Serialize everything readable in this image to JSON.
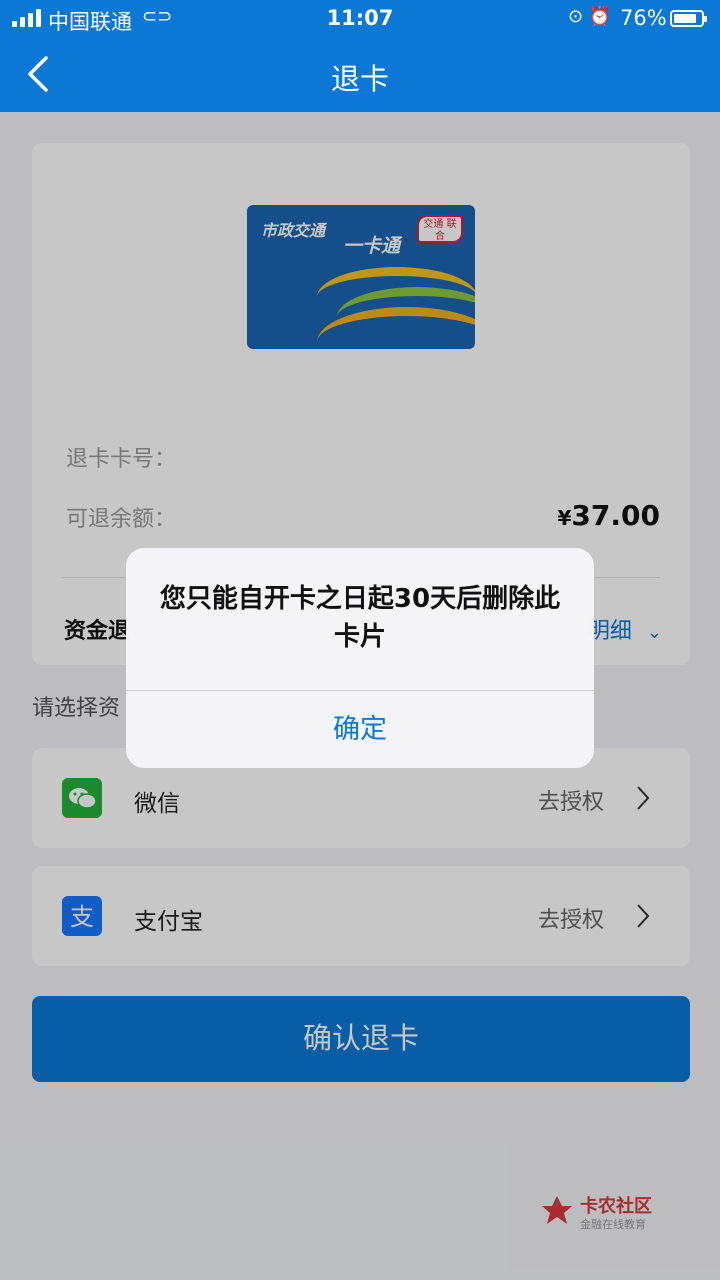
{
  "status_bar": {
    "carrier": "中国联通",
    "time": "11:07",
    "battery": "76%"
  },
  "nav": {
    "title": "退卡"
  },
  "card": {
    "logo_text": "市政交通",
    "logo_text2": "一卡通",
    "badge_text": "交通 联合"
  },
  "info": {
    "card_number_label": "退卡卡号：",
    "refundable_label": "可退余额：",
    "amount_symbol": "¥",
    "amount_value": "37.00",
    "fund_label": "资金退",
    "detail_label": "明细"
  },
  "select_label": "请选择资",
  "payment_options": [
    {
      "name": "微信",
      "action": "去授权"
    },
    {
      "name": "支付宝",
      "action": "去授权"
    }
  ],
  "confirm_button": "确认退卡",
  "watermark": {
    "title": "卡农社区",
    "subtitle": "金融在线教育"
  },
  "alert": {
    "message": "您只能自开卡之日起30天后删除此卡片",
    "button": "确定"
  },
  "colors": {
    "primary": "#0b78d6",
    "wechat": "#23b33a",
    "alipay": "#1677ff"
  }
}
